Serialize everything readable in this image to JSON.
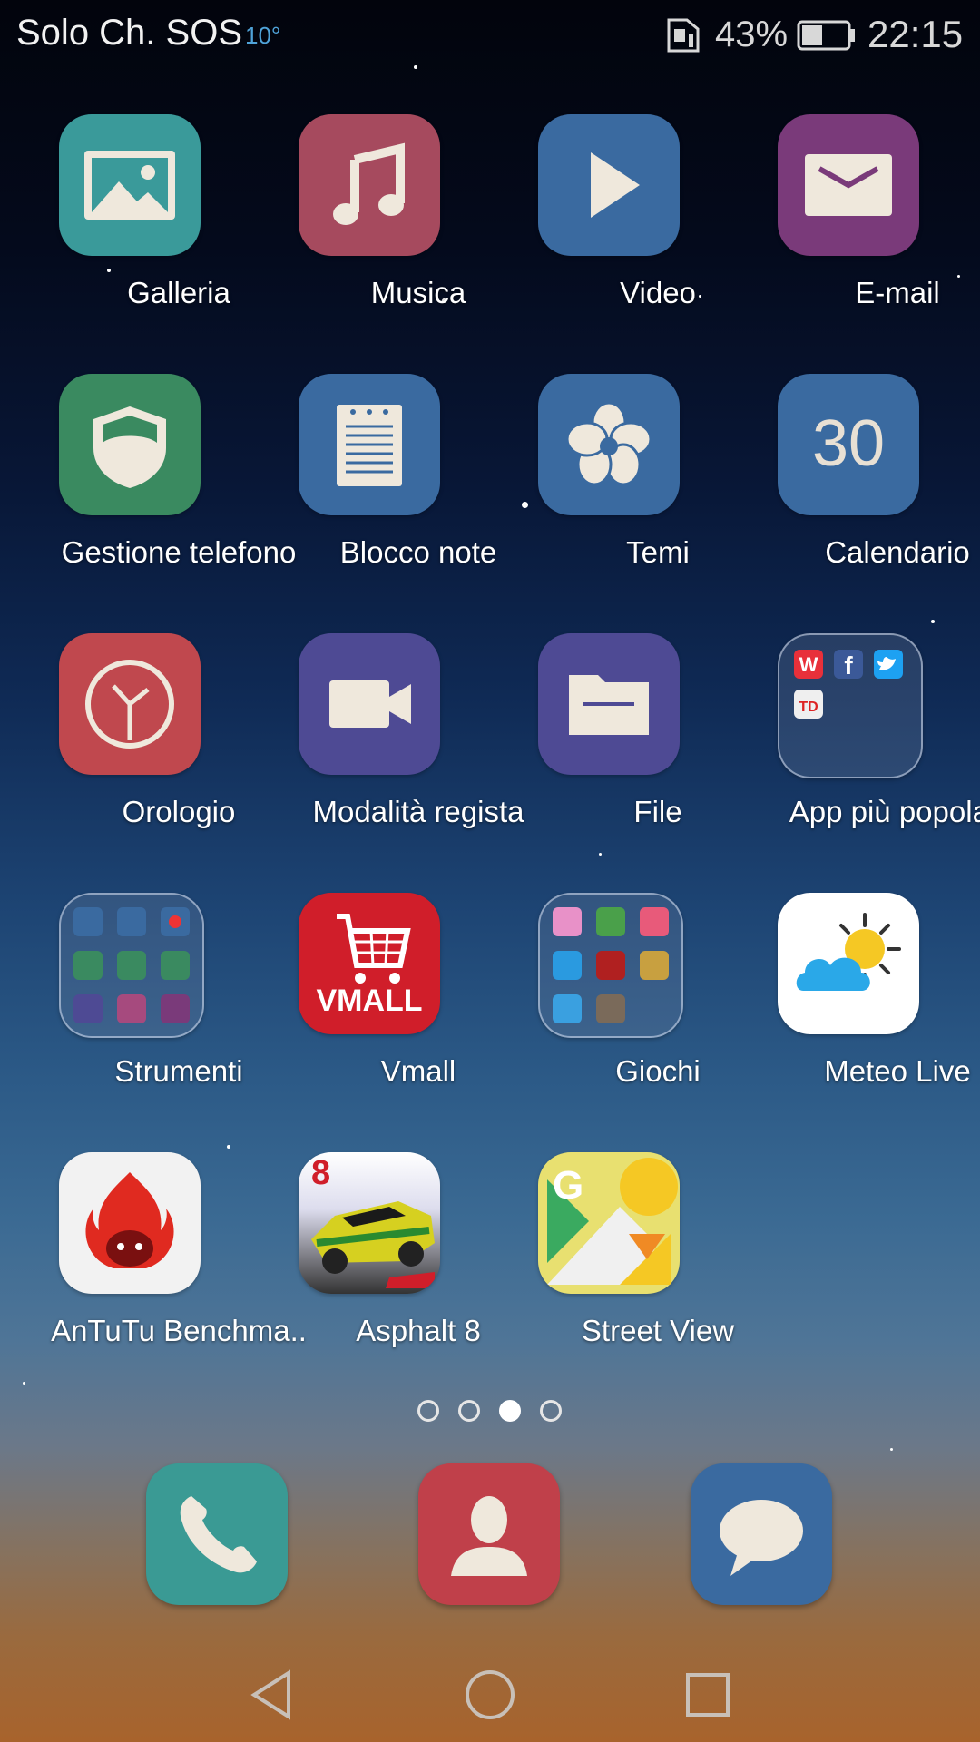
{
  "status_bar": {
    "carrier": "Solo Ch. SOS",
    "temperature": "10°",
    "battery_percent": "43%",
    "time": "22:15",
    "icons": [
      "sim-card-icon",
      "battery-icon"
    ]
  },
  "apps": [
    {
      "label": "Galleria",
      "icon": "gallery-icon",
      "color": "#3a9a9a"
    },
    {
      "label": "Musica",
      "icon": "music-icon",
      "color": "#a64a5e"
    },
    {
      "label": "Video",
      "icon": "video-play-icon",
      "color": "#3a6aa0"
    },
    {
      "label": "E-mail",
      "icon": "email-icon",
      "color": "#7a3a7a"
    },
    {
      "label": "Gestione telefono",
      "icon": "shield-icon",
      "color": "#3a8a60"
    },
    {
      "label": "Blocco note",
      "icon": "notepad-icon",
      "color": "#3a6aa0"
    },
    {
      "label": "Temi",
      "icon": "themes-flower-icon",
      "color": "#3a6aa0"
    },
    {
      "label": "Calendario",
      "icon": "calendar-icon",
      "color": "#3a6aa0",
      "icon_text": "30"
    },
    {
      "label": "Orologio",
      "icon": "clock-icon",
      "color": "#c0484e"
    },
    {
      "label": "Modalità regista",
      "icon": "video-camera-icon",
      "color": "#4e4a94"
    },
    {
      "label": "File",
      "icon": "folder-icon",
      "color": "#4e4a94"
    },
    {
      "label": "App più popolari",
      "icon": "app-folder-icon",
      "color": "#2a3a5a"
    },
    {
      "label": "Strumenti",
      "icon": "tools-folder-icon",
      "color": "#2f4a6e"
    },
    {
      "label": "Vmall",
      "icon": "vmall-cart-icon",
      "color": "#d01e2a",
      "icon_text": "VMALL"
    },
    {
      "label": "Giochi",
      "icon": "games-folder-icon",
      "color": "#2f4a6e"
    },
    {
      "label": "Meteo Live",
      "icon": "weather-icon",
      "color": "#ffffff"
    },
    {
      "label": "AnTuTu Benchma..",
      "icon": "antutu-icon",
      "color": "#f2f2f2"
    },
    {
      "label": "Asphalt 8",
      "icon": "asphalt-car-icon",
      "color": "#c7c23a",
      "icon_text": "8"
    },
    {
      "label": "Street View",
      "icon": "street-view-icon",
      "color": "#e8e070",
      "icon_text": "G"
    }
  ],
  "folder_badges": {
    "popular": [
      "W",
      "f",
      "TD"
    ]
  },
  "page_indicator": {
    "pages": 4,
    "current": 3
  },
  "dock": [
    {
      "icon": "phone-icon",
      "color": "#3a9a94"
    },
    {
      "icon": "contacts-icon",
      "color": "#c0404a"
    },
    {
      "icon": "messages-icon",
      "color": "#3a6aa0"
    }
  ],
  "nav_bar": [
    "back-icon",
    "home-icon",
    "recents-icon"
  ]
}
